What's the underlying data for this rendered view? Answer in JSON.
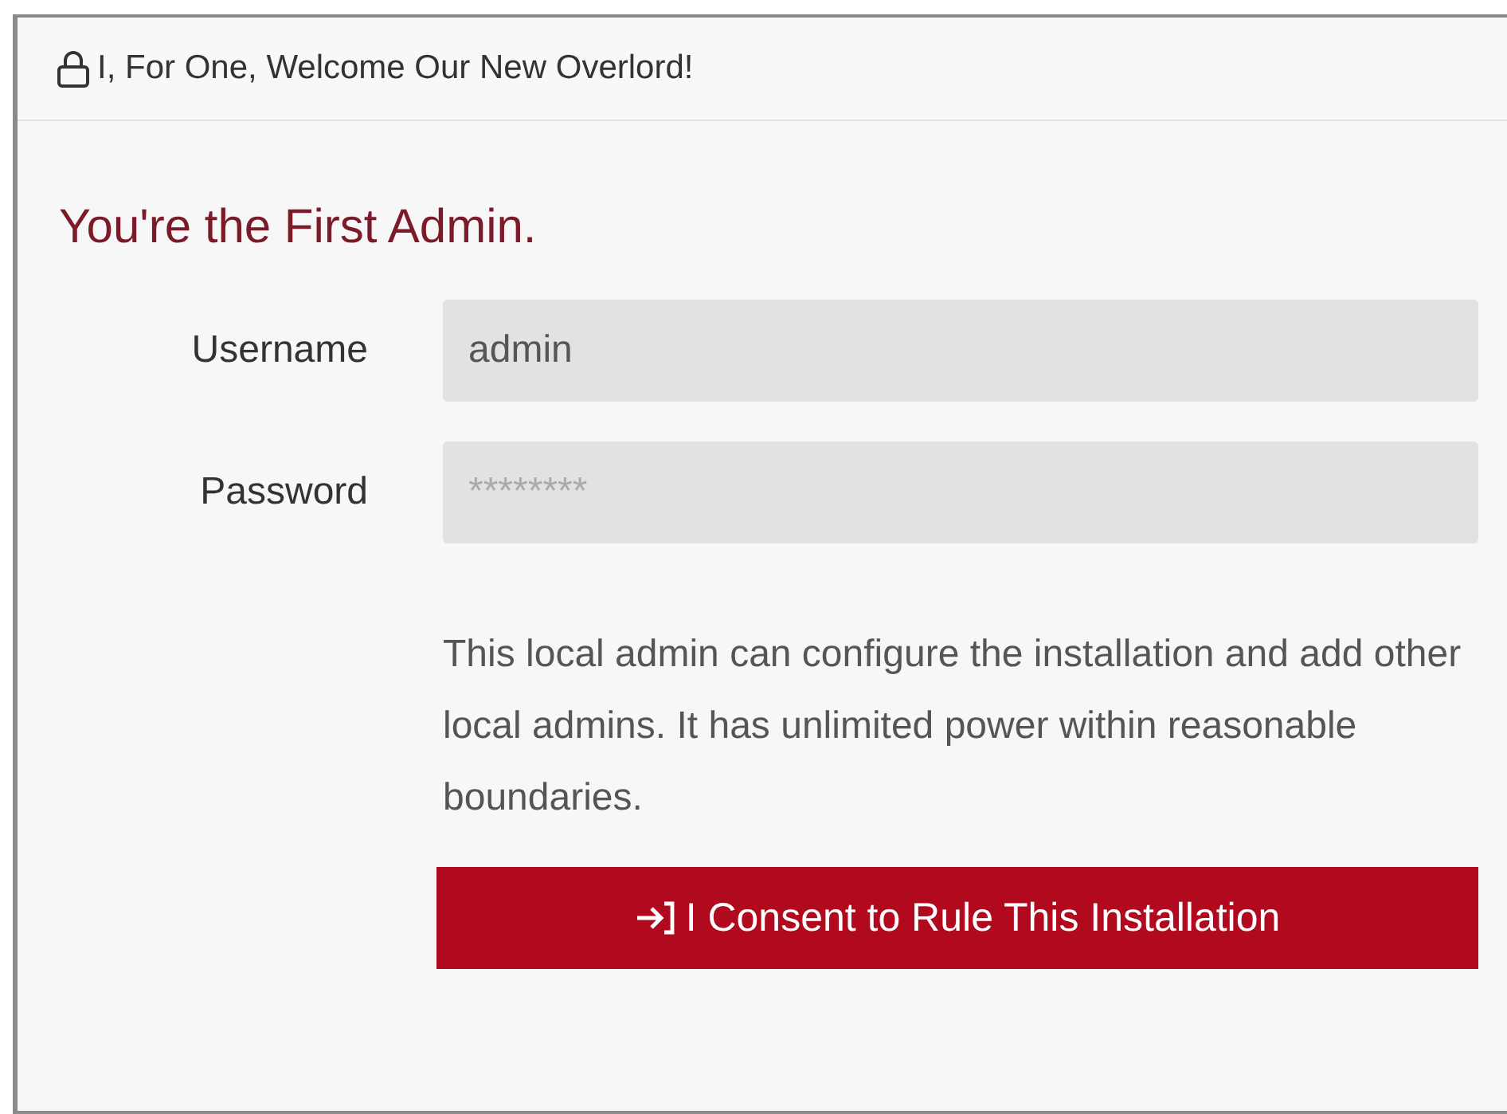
{
  "panel": {
    "title": "I, For One, Welcome Our New Overlord!"
  },
  "heading": "You're the First Admin.",
  "fields": [
    {
      "label": "Username",
      "value": "admin"
    },
    {
      "label": "Password",
      "placeholder": "********"
    }
  ],
  "description": "This local admin can configure the installation and add other local admins. It has unlimited power within reasonable boundaries.",
  "submit_button": {
    "label": "I Consent to Rule This Installation"
  }
}
